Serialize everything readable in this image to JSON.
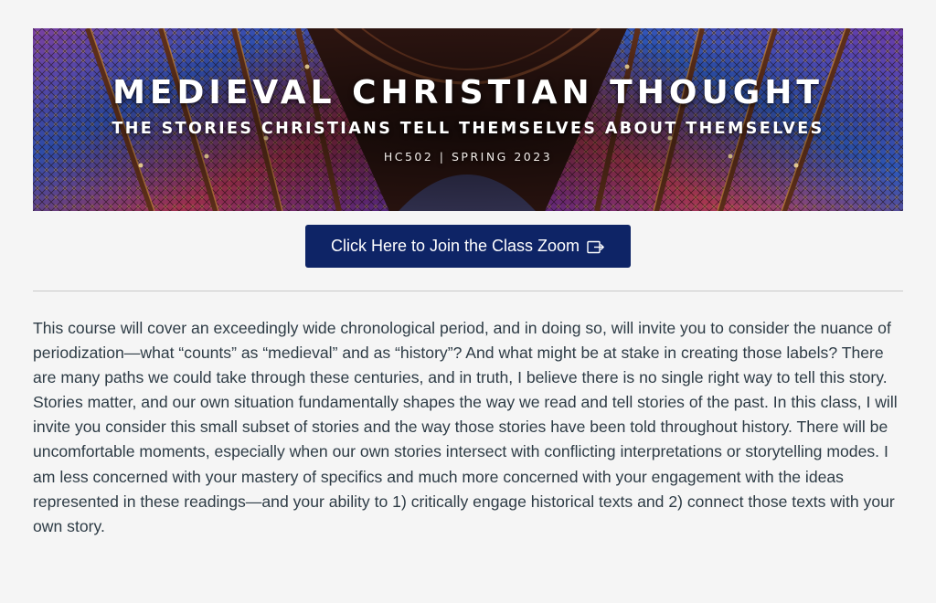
{
  "banner": {
    "title": "MEDIEVAL CHRISTIAN THOUGHT",
    "subtitle": "THE STORIES CHRISTIANS TELL THEMSELVES ABOUT THEMSELVES",
    "course": "HC502 | SPRING 2023",
    "image": "cathedral-stained-glass-interior"
  },
  "zoom_button": {
    "label": "Click Here to Join the Class Zoom",
    "icon": "external-link-icon",
    "color": "#0e2466"
  },
  "description": {
    "text": "This course will cover an exceedingly wide chronological period, and in doing so, will invite you to consider the nuance of periodization—what “counts” as “medieval” and as “history”? And what might be at stake in creating those labels? There are many paths we could take through these centuries, and in truth, I believe there is no single right way to tell this story. Stories matter, and our own situation fundamentally shapes the way we read and tell stories of the past.  In this class, I will invite you consider this small subset of stories and the way those stories have been told throughout history. There will be uncomfortable moments, especially when our own stories intersect with conflicting interpretations or storytelling modes. I am less concerned with your mastery of specifics and much more concerned with your engagement with the ideas represented in these readings—and your ability to 1) critically engage historical texts and 2) connect those texts with your own story."
  }
}
